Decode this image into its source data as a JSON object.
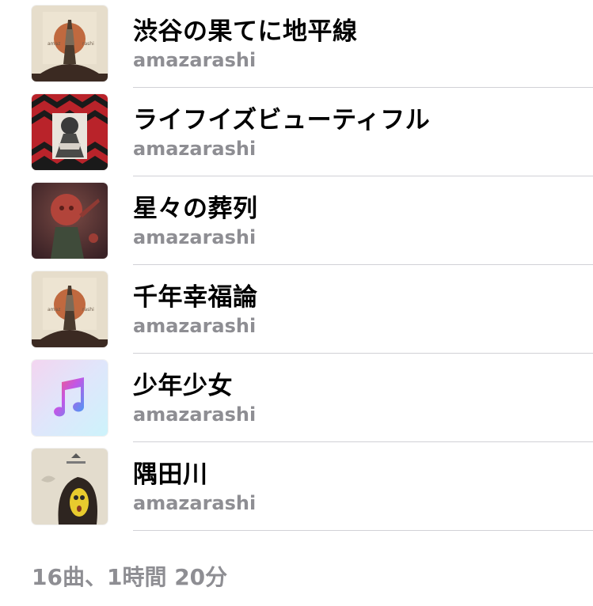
{
  "songs": [
    {
      "title": "渋谷の果てに地平線",
      "artist": "amazarashi",
      "artwork": "album-art-sun-figure"
    },
    {
      "title": "ライフイズビューティフル",
      "artist": "amazarashi",
      "artwork": "album-art-red-chevron"
    },
    {
      "title": "星々の葬列",
      "artist": "amazarashi",
      "artwork": "album-art-red-mask"
    },
    {
      "title": "千年幸福論",
      "artist": "amazarashi",
      "artwork": "album-art-sun-figure"
    },
    {
      "title": "少年少女",
      "artist": "amazarashi",
      "artwork": "music-note-icon"
    },
    {
      "title": "隅田川",
      "artist": "amazarashi",
      "artwork": "album-art-yellow-face"
    }
  ],
  "summary": "16曲、1時間 20分",
  "colors": {
    "title": "#000000",
    "secondary": "#8e8e93",
    "separator": "#d1d1d6"
  }
}
